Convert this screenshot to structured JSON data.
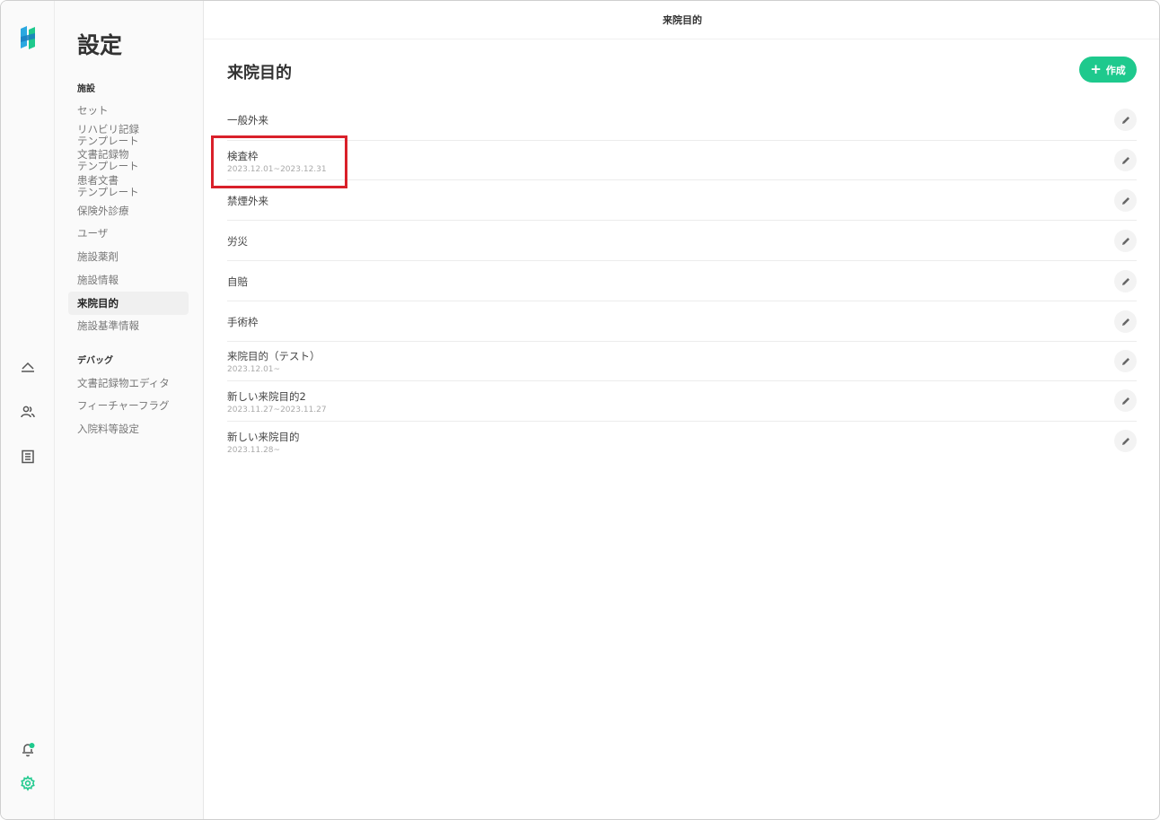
{
  "topbar": {
    "title": "来院目的"
  },
  "settings_nav": {
    "title": "設定",
    "sections": [
      {
        "label": "施設",
        "items": [
          {
            "label": "セット"
          },
          {
            "label": "リハビリ記録\nテンプレート"
          },
          {
            "label": "文書記録物\nテンプレート"
          },
          {
            "label": "患者文書\nテンプレート"
          },
          {
            "label": "保険外診療"
          },
          {
            "label": "ユーザ"
          },
          {
            "label": "施設薬剤"
          },
          {
            "label": "施設情報"
          },
          {
            "label": "来院目的",
            "active": true
          },
          {
            "label": "施設基準情報"
          }
        ]
      },
      {
        "label": "デバッグ",
        "items": [
          {
            "label": "文書記録物エディタ"
          },
          {
            "label": "フィーチャーフラグ"
          },
          {
            "label": "入院料等設定"
          }
        ]
      }
    ]
  },
  "main": {
    "title": "来院目的",
    "create_label": "作成",
    "items": [
      {
        "name": "一般外来",
        "period": ""
      },
      {
        "name": "検査枠",
        "period": "2023.12.01~2023.12.31"
      },
      {
        "name": "禁煙外来",
        "period": ""
      },
      {
        "name": "労災",
        "period": ""
      },
      {
        "name": "自賠",
        "period": ""
      },
      {
        "name": "手術枠",
        "period": ""
      },
      {
        "name": "来院目的（テスト）",
        "period": "2023.12.01~"
      },
      {
        "name": "新しい来院目的2",
        "period": "2023.11.27~2023.11.27"
      },
      {
        "name": "新しい来院目的",
        "period": "2023.11.28~"
      }
    ]
  },
  "colors": {
    "accent": "#1ec98d",
    "highlight": "#d9202a"
  },
  "icons": [
    "logo-icon",
    "tray-icon",
    "users-icon",
    "list-icon",
    "bell-icon",
    "gear-icon",
    "plus-icon",
    "pencil-icon"
  ]
}
